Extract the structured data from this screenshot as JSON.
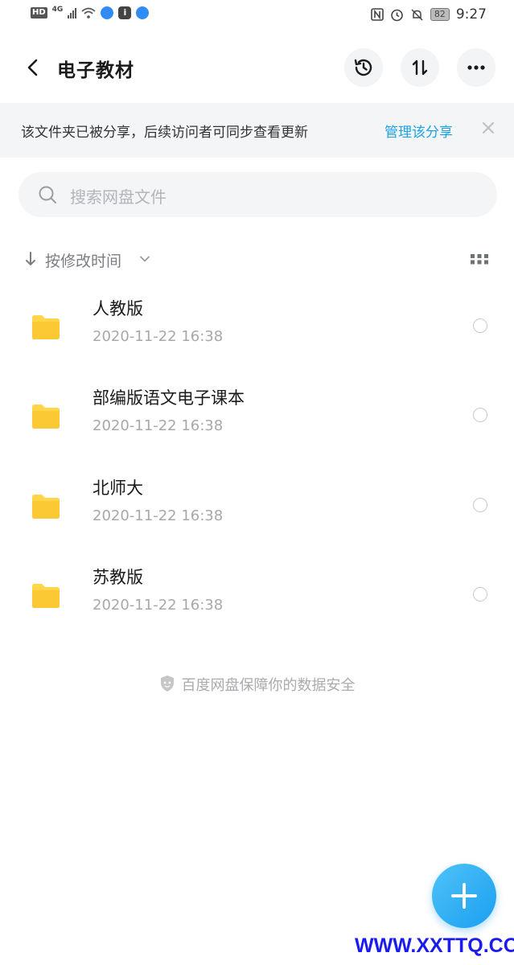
{
  "status_bar": {
    "hd": "HD",
    "network": "4G",
    "app_badge": "i",
    "battery": "82",
    "time": "9:27",
    "icons": [
      "nfc-icon",
      "alarm-icon",
      "mute-bell-icon"
    ]
  },
  "header": {
    "title": "电子教材",
    "actions": [
      "history-icon",
      "transfer-icon",
      "more-icon"
    ]
  },
  "share_banner": {
    "text": "该文件夹已被分享，后续访问者可同步查看更新",
    "link": "管理该分享"
  },
  "search": {
    "placeholder": "搜索网盘文件"
  },
  "sort": {
    "label": "按修改时间"
  },
  "files": [
    {
      "name": "人教版",
      "date": "2020-11-22  16:38"
    },
    {
      "name": "部编版语文电子课本",
      "date": "2020-11-22  16:38"
    },
    {
      "name": "北师大",
      "date": "2020-11-22  16:38"
    },
    {
      "name": "苏教版",
      "date": "2020-11-22  16:38"
    }
  ],
  "safety_note": "百度网盘保障你的数据安全",
  "watermark": "WWW.XXTTQ.COM",
  "colors": {
    "accent": "#1aa3e8",
    "folder": "#ffd54a",
    "fab": "#1a9ff0"
  }
}
